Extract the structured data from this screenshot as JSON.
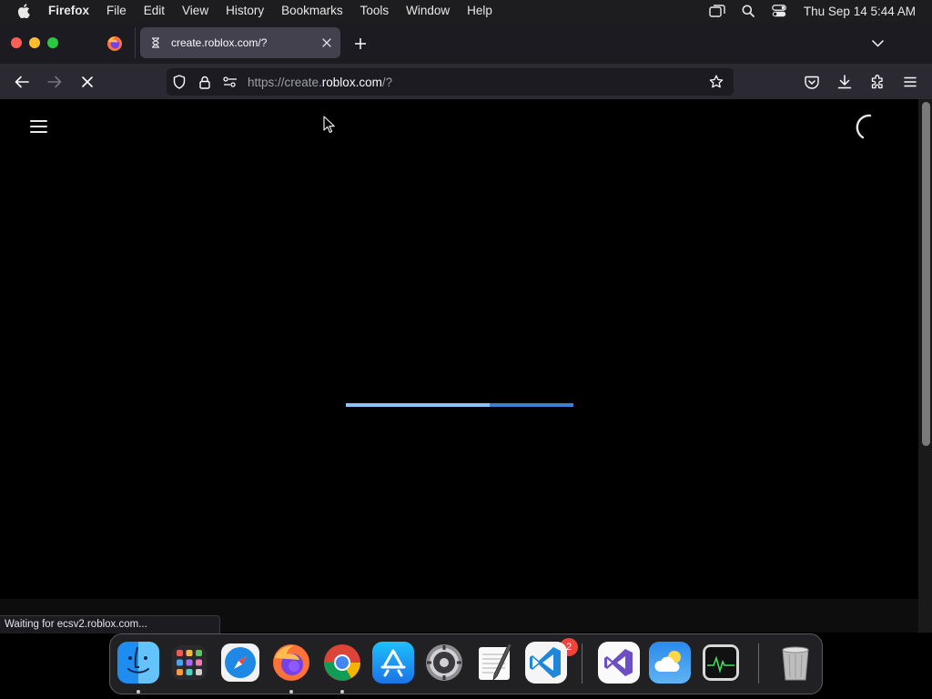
{
  "menubar": {
    "app_name": "Firefox",
    "menus": [
      "File",
      "Edit",
      "View",
      "History",
      "Bookmarks",
      "Tools",
      "Window",
      "Help"
    ],
    "clock": "Thu Sep 14  5:44 AM"
  },
  "tabs": {
    "active_title": "create.roblox.com/?"
  },
  "toolbar": {
    "url_prefix": "https://create.",
    "url_host": "roblox.com",
    "url_suffix": "/?"
  },
  "page": {
    "loading_progress_fraction": 0.63
  },
  "status_text": "Waiting for ecsv2.roblox.com...",
  "dock": {
    "settings_badge": "2",
    "items": [
      "Finder",
      "Launchpad",
      "Safari",
      "Firefox",
      "Chrome",
      "App Store",
      "System Settings",
      "TextEdit",
      "Visual Studio Code",
      "Visual Studio",
      "Weather",
      "Activity Monitor",
      "Trash"
    ]
  },
  "colors": {
    "accent": "#3d7fd1",
    "progress_fill": "#8ec1f4"
  }
}
